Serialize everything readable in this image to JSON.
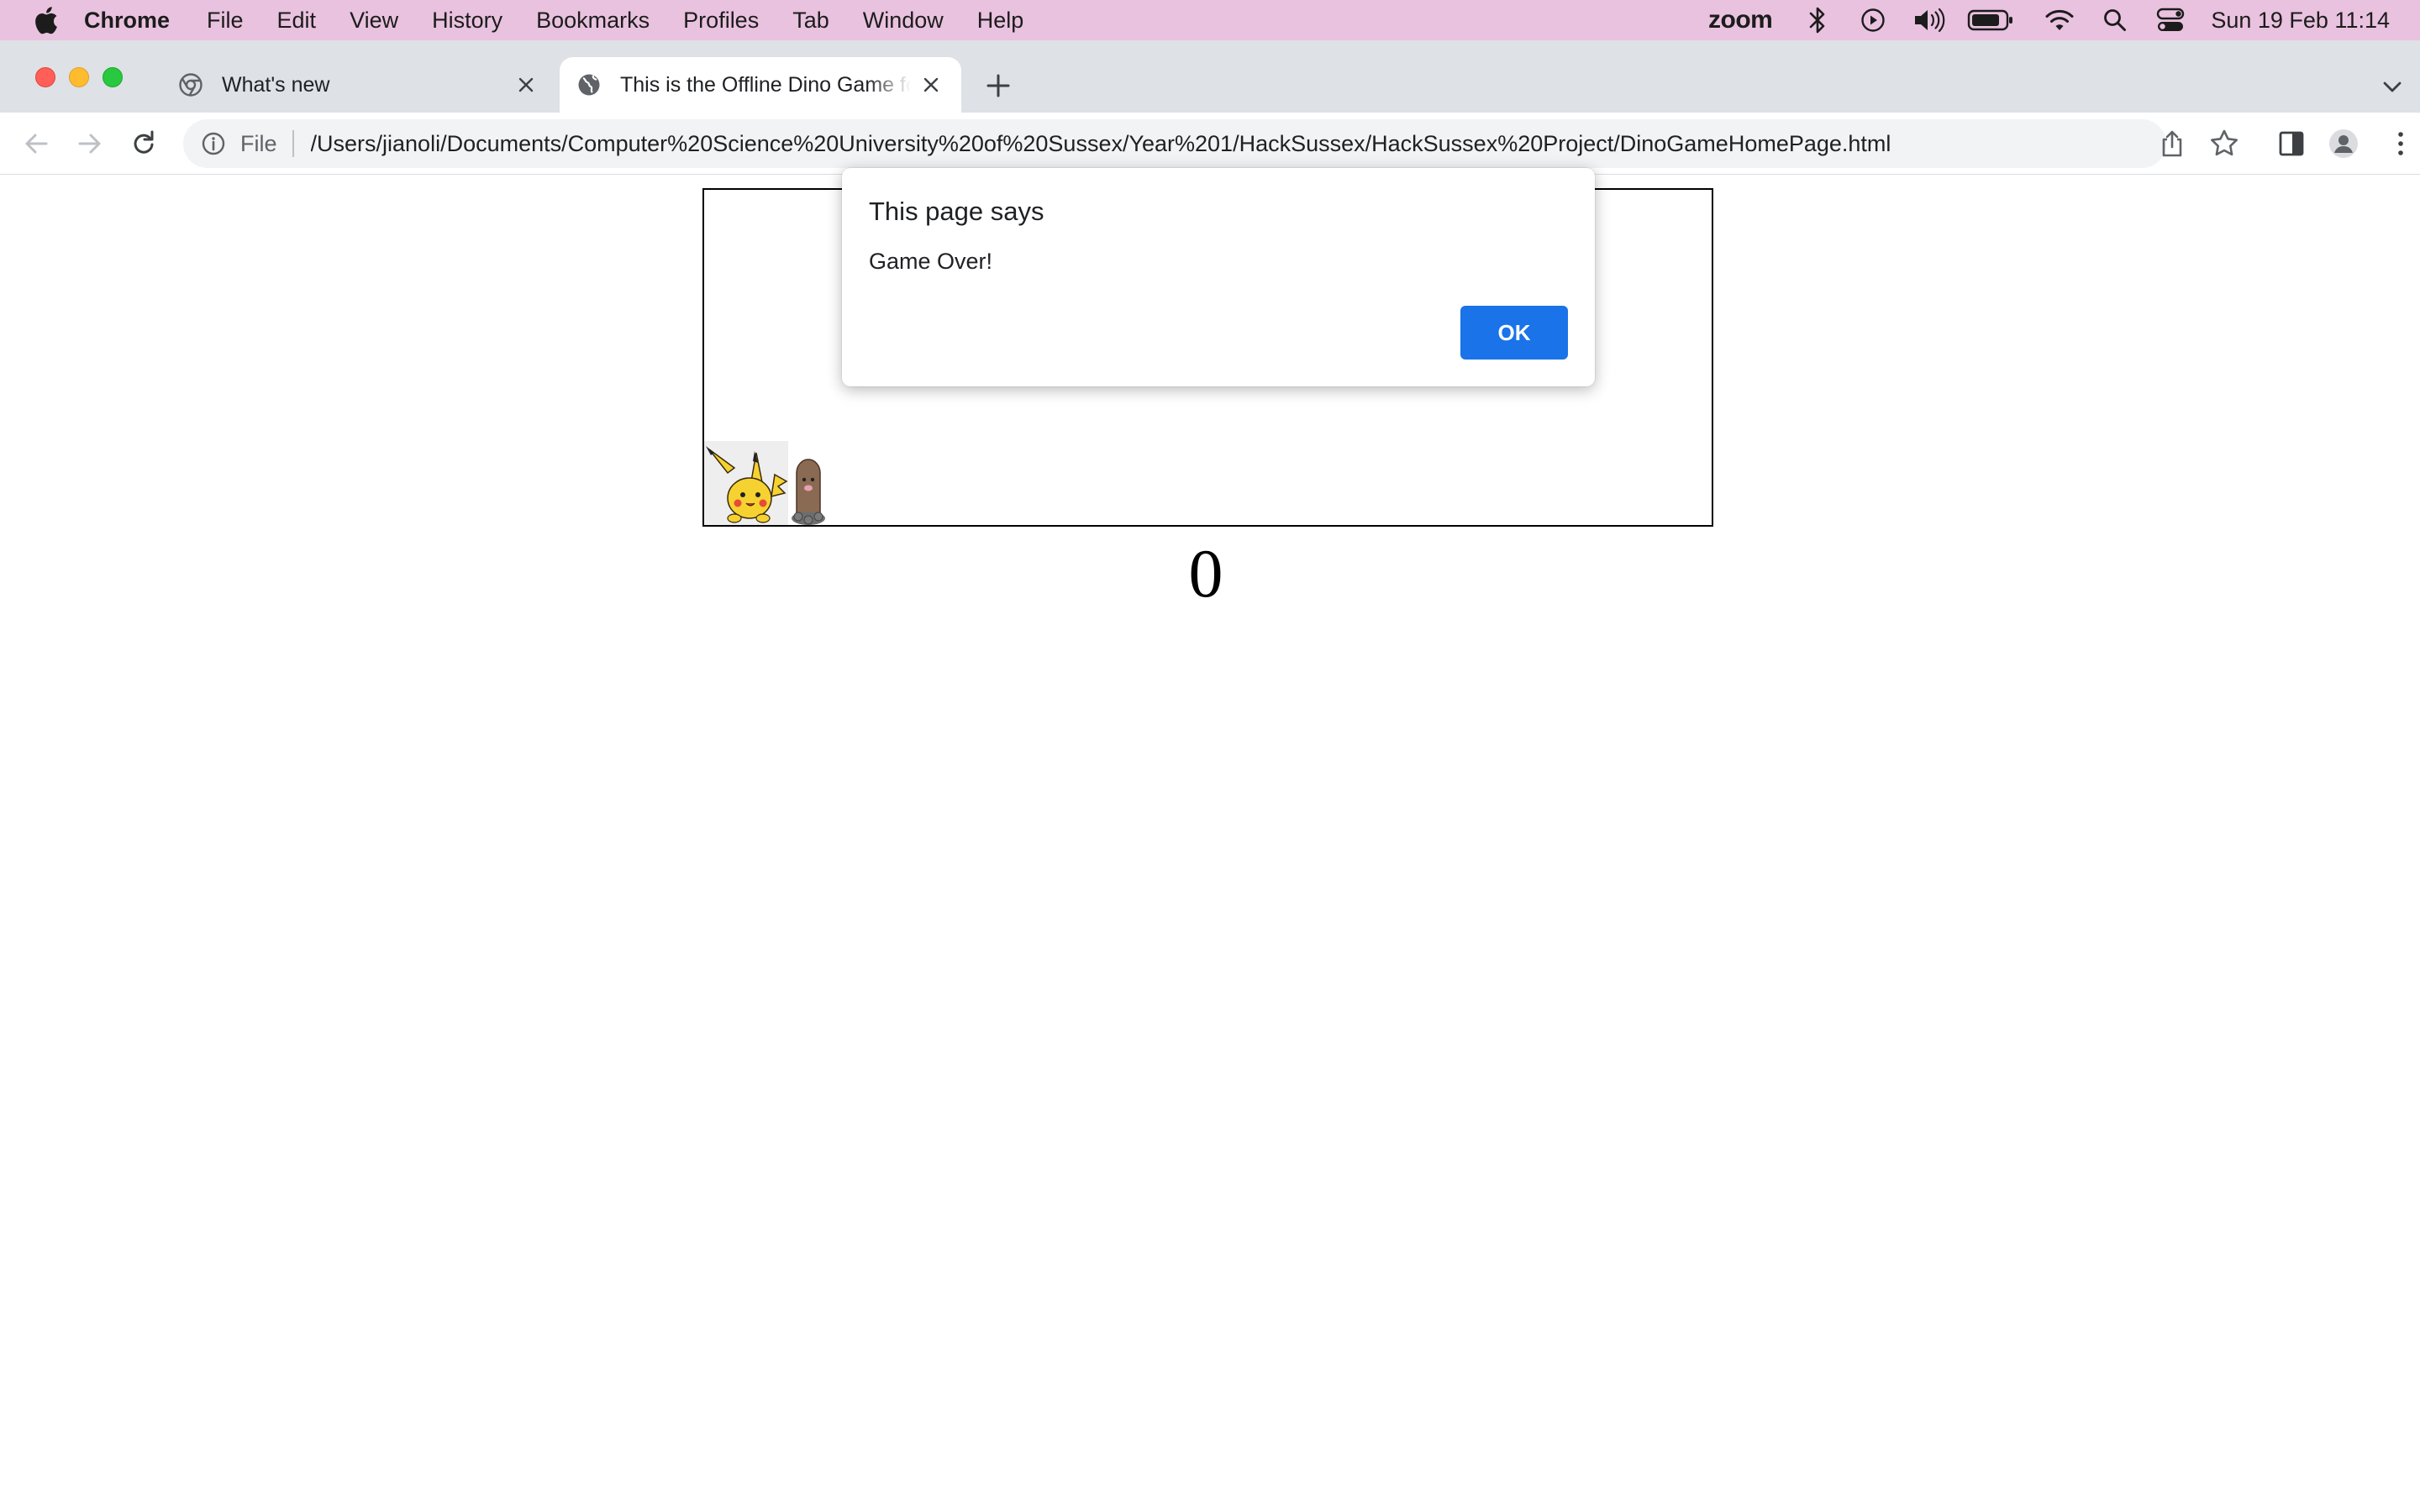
{
  "menubar": {
    "app_name": "Chrome",
    "items": [
      "File",
      "Edit",
      "View",
      "History",
      "Bookmarks",
      "Profiles",
      "Tab",
      "Window",
      "Help"
    ],
    "zoom_label": "zoom",
    "clock": "Sun 19 Feb  11:14"
  },
  "tabs": [
    {
      "title": "What's new",
      "icon": "chrome-icon",
      "active": false
    },
    {
      "title": "This is the Offline Dino Game for HackSussex",
      "icon": "globe-icon",
      "active": true
    }
  ],
  "toolbar": {
    "scheme": "File",
    "url": "/Users/jianoli/Documents/Computer%20Science%20University%20of%20Sussex/Year%201/HackSussex/HackSussex%20Project/DinoGameHomePage.html"
  },
  "game": {
    "score": "0"
  },
  "dialog": {
    "title": "This page says",
    "message": "Game Over!",
    "ok_label": "OK",
    "accent": "#1a73e8"
  },
  "colors": {
    "menubar_bg": "#e9c2df",
    "tabstrip_bg": "#dee1e6"
  }
}
